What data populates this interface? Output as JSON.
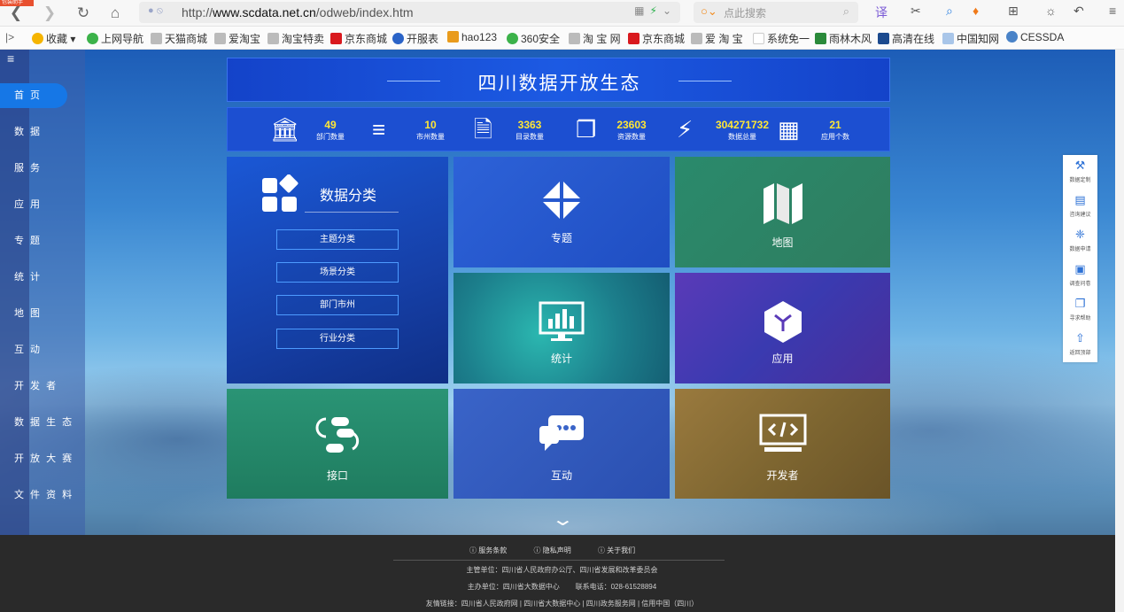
{
  "browser": {
    "badge": "包装助手",
    "url_prefix": "http://",
    "url_domain": "www.scdata.net.cn",
    "url_path": "/odweb/index.htm",
    "search_placeholder": "点此搜索",
    "translate_label": "译"
  },
  "bookmarks": [
    {
      "label": "收藏",
      "color": "#f5b400"
    },
    {
      "label": "上网导航",
      "color": "#3cb24a"
    },
    {
      "label": "天猫商城",
      "color": "#bbbbbb"
    },
    {
      "label": "爱淘宝",
      "color": "#bbbbbb"
    },
    {
      "label": "淘宝特卖",
      "color": "#bbbbbb"
    },
    {
      "label": "京东商城",
      "color": "#d9191e"
    },
    {
      "label": "开服表",
      "color": "#2a63c7"
    },
    {
      "label": "hao123",
      "color": "#e99b1c"
    },
    {
      "label": "360安全",
      "color": "#3cb24a"
    },
    {
      "label": "淘 宝 网",
      "color": "#bbbbbb"
    },
    {
      "label": "京东商城",
      "color": "#d9191e"
    },
    {
      "label": "爱 淘 宝",
      "color": "#bbbbbb"
    },
    {
      "label": "系统免一",
      "color": "#cccccc"
    },
    {
      "label": "雨林木风",
      "color": "#2a8a3a"
    },
    {
      "label": "高清在线",
      "color": "#1c4a8e"
    },
    {
      "label": "中国知网",
      "color": "#a9c6e9"
    },
    {
      "label": "CESSDA",
      "color": "#4a83c8"
    }
  ],
  "sidebar": {
    "items": [
      {
        "label": "首 页",
        "active": true
      },
      {
        "label": "数 据"
      },
      {
        "label": "服 务"
      },
      {
        "label": "应 用"
      },
      {
        "label": "专 题"
      },
      {
        "label": "统 计"
      },
      {
        "label": "地 图"
      },
      {
        "label": "互 动"
      },
      {
        "label": "开 发 者"
      },
      {
        "label": "数 据 生 态"
      },
      {
        "label": "开 放 大 赛"
      },
      {
        "label": "文 件 资 料"
      }
    ]
  },
  "header": {
    "title": "四川数据开放生态"
  },
  "stats": [
    {
      "value": "49",
      "label": "部门数量",
      "icon": "bank-icon"
    },
    {
      "value": "10",
      "label": "市州数量",
      "icon": "list-icon"
    },
    {
      "value": "3363",
      "label": "目录数量",
      "icon": "document-icon"
    },
    {
      "value": "23603",
      "label": "资源数量",
      "icon": "copy-icon"
    },
    {
      "value": "304271732",
      "label": "数据总量",
      "icon": "plug-icon"
    },
    {
      "value": "21",
      "label": "应用个数",
      "icon": "grid-icon"
    }
  ],
  "tiles": {
    "category": {
      "title": "数据分类",
      "buttons": [
        "主题分类",
        "场景分类",
        "部门市州",
        "行业分类"
      ]
    },
    "topic": "专题",
    "map": "地图",
    "stats": "统计",
    "app": "应用",
    "api": "接口",
    "interact": "互动",
    "developer": "开发者"
  },
  "right_tools": [
    {
      "label": "数据定制",
      "icon": "tools-icon"
    },
    {
      "label": "咨询建议",
      "icon": "chat-icon"
    },
    {
      "label": "数据申请",
      "icon": "bulb-icon"
    },
    {
      "label": "调查问卷",
      "icon": "form-icon"
    },
    {
      "label": "寻求帮助",
      "icon": "help-icon"
    },
    {
      "label": "返回顶部",
      "icon": "arrow-up-icon"
    }
  ],
  "footer": {
    "links": [
      "服务条款",
      "隐私声明",
      "关于我们"
    ],
    "sponsor": "主管单位：四川省人民政府办公厅、四川省发展和改革委员会",
    "organizer": "主办单位：四川省大数据中心",
    "phone": "联系电话：028-61528894",
    "friends": "友情链接：四川省人民政府网 | 四川省大数据中心 | 四川政务服务网 | 信用中国（四川）"
  }
}
